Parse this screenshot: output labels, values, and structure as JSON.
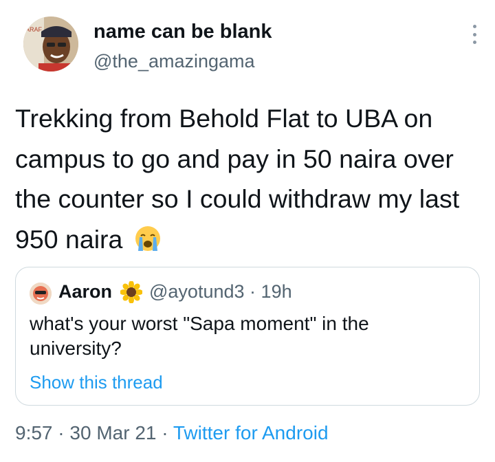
{
  "tweet": {
    "author": {
      "display_name": "name can be blank",
      "handle": "@the_amazingama",
      "avatar_icon": "user-avatar-photo"
    },
    "text": "Trekking from Behold Flat to UBA on campus to go and pay in 50 naira over the counter so I could withdraw my last 950 naira",
    "emoji": "sob-emoji",
    "more_icon": "vertical-ellipsis-icon"
  },
  "quoted_tweet": {
    "name": "Aaron",
    "badge_emoji": "sunflower-emoji",
    "handle": "@ayotund3",
    "separator": "·",
    "time": "19h",
    "text": "what's your worst \"Sapa moment\" in the university?",
    "link_label": "Show this thread"
  },
  "footer": {
    "time": "9:57",
    "separator1": "·",
    "date": "30 Mar 21",
    "separator2": "·",
    "source": "Twitter for Android"
  },
  "colors": {
    "text": "#0f1419",
    "secondary": "#536471",
    "link": "#1d9bf0",
    "border": "#cfd9de"
  }
}
